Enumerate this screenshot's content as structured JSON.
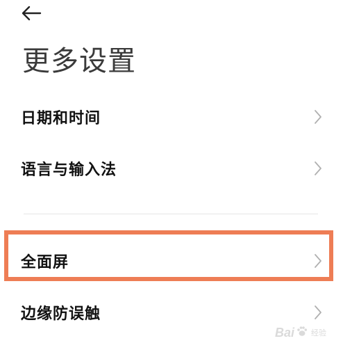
{
  "header": {
    "back_icon": "arrow-left-icon",
    "title": "更多设置"
  },
  "settings": {
    "items": [
      {
        "label": "日期和时间",
        "icon": "chevron-right-icon"
      },
      {
        "label": "语言与输入法",
        "icon": "chevron-right-icon"
      },
      {
        "label": "全面屏",
        "icon": "chevron-right-icon",
        "highlighted": true
      },
      {
        "label": "边缘防误触",
        "icon": "chevron-right-icon"
      }
    ]
  },
  "watermark": {
    "text": "Bai",
    "sub": "经验"
  },
  "colors": {
    "highlight_border": "#ee7d55",
    "chevron": "#b0b0b0",
    "divider": "#e6e6e6"
  }
}
